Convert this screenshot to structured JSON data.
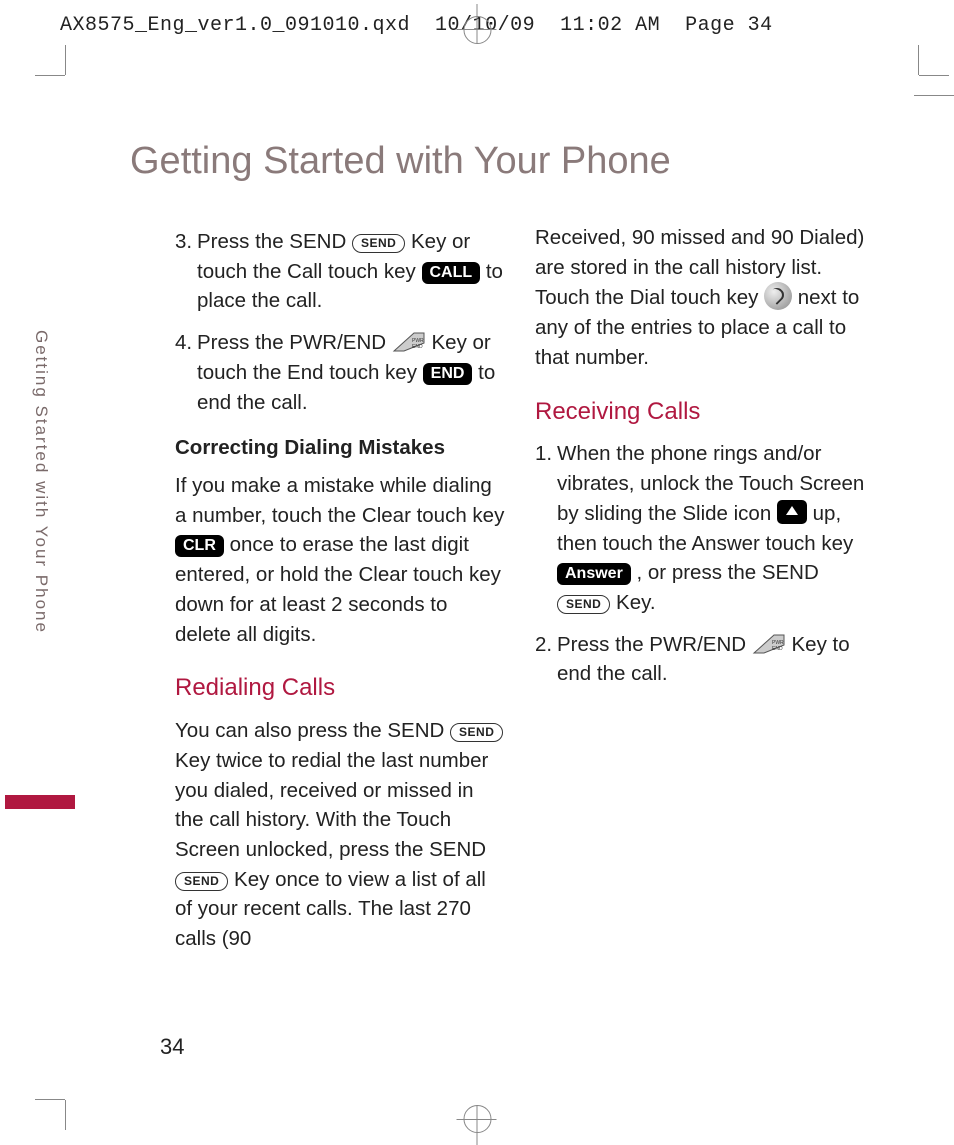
{
  "slug": "AX8575_Eng_ver1.0_091010.qxd  10/10/09  11:02 AM  Page 34",
  "page_title": "Getting Started with Your Phone",
  "side_label": "Getting Started with Your Phone",
  "icons": {
    "send": "SEND",
    "call": "CALL",
    "end": "END",
    "clr": "CLR",
    "answer": "Answer"
  },
  "col1": {
    "step3": {
      "num": "3.",
      "a": "Press the SEND ",
      "b": " Key or touch the Call touch key ",
      "c": " to place the call."
    },
    "step4": {
      "num": "4.",
      "a": "Press the PWR/END ",
      "b": " Key or touch the End touch key ",
      "c": " to end the call."
    },
    "correcting_h": "Correcting Dialing Mistakes",
    "correcting_a": "If you make a mistake while dialing a number, touch the Clear touch key ",
    "correcting_b": " once to erase the last digit entered, or hold the Clear touch key down for at least 2 seconds to delete all digits.",
    "redial_h": "Redialing Calls",
    "redial_a": "You can also press the SEND ",
    "redial_b": " Key twice to redial the last number you dialed, received or missed in the call history. With the Touch Screen unlocked, press the SEND ",
    "redial_c": " Key once to view a list of all of your recent calls. The last 270 calls (90"
  },
  "col2": {
    "cont_a": "Received, 90 missed and 90 Dialed) are stored in the call history list. Touch the Dial touch key ",
    "cont_b": " next to any of the entries to place a call to that number.",
    "recv_h": "Receiving Calls",
    "recv1": {
      "num": "1.",
      "a": "When the phone rings and/or vibrates, unlock the Touch Screen by sliding the Slide icon ",
      "b": " up, then touch the Answer touch key ",
      "c": ", or press the SEND ",
      "d": " Key."
    },
    "recv2": {
      "num": "2.",
      "a": "Press the PWR/END ",
      "b": " Key to end the call."
    }
  },
  "page_number": "34"
}
